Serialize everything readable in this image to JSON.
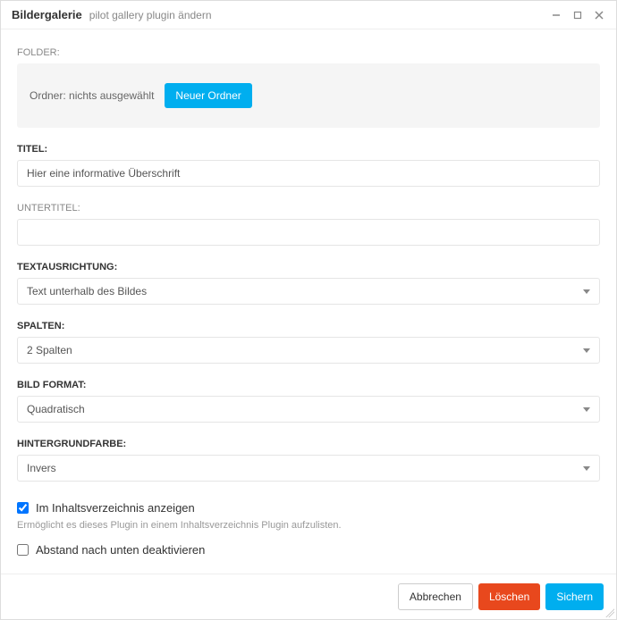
{
  "header": {
    "title": "Bildergalerie",
    "subtitle": "pilot gallery plugin ändern"
  },
  "folder": {
    "label": "FOLDER:",
    "status_text": "Ordner: nichts ausgewählt",
    "new_button": "Neuer Ordner"
  },
  "title_field": {
    "label": "TITEL:",
    "value": "Hier eine informative Überschrift"
  },
  "subtitle_field": {
    "label": "UNTERTITEL:",
    "value": ""
  },
  "text_align": {
    "label": "TEXTAUSRICHTUNG:",
    "selected": "Text unterhalb des Bildes"
  },
  "columns": {
    "label": "SPALTEN:",
    "selected": "2 Spalten"
  },
  "image_format": {
    "label": "BILD FORMAT:",
    "selected": "Quadratisch"
  },
  "background": {
    "label": "HINTERGRUNDFARBE:",
    "selected": "Invers"
  },
  "toc_checkbox": {
    "label": "Im Inhaltsverzeichnis anzeigen",
    "checked": true,
    "help": "Ermöglicht es dieses Plugin in einem Inhaltsverzeichnis Plugin aufzulisten."
  },
  "spacing_checkbox": {
    "label": "Abstand nach unten deaktivieren",
    "checked": false
  },
  "footer": {
    "cancel": "Abbrechen",
    "delete": "Löschen",
    "save": "Sichern"
  }
}
